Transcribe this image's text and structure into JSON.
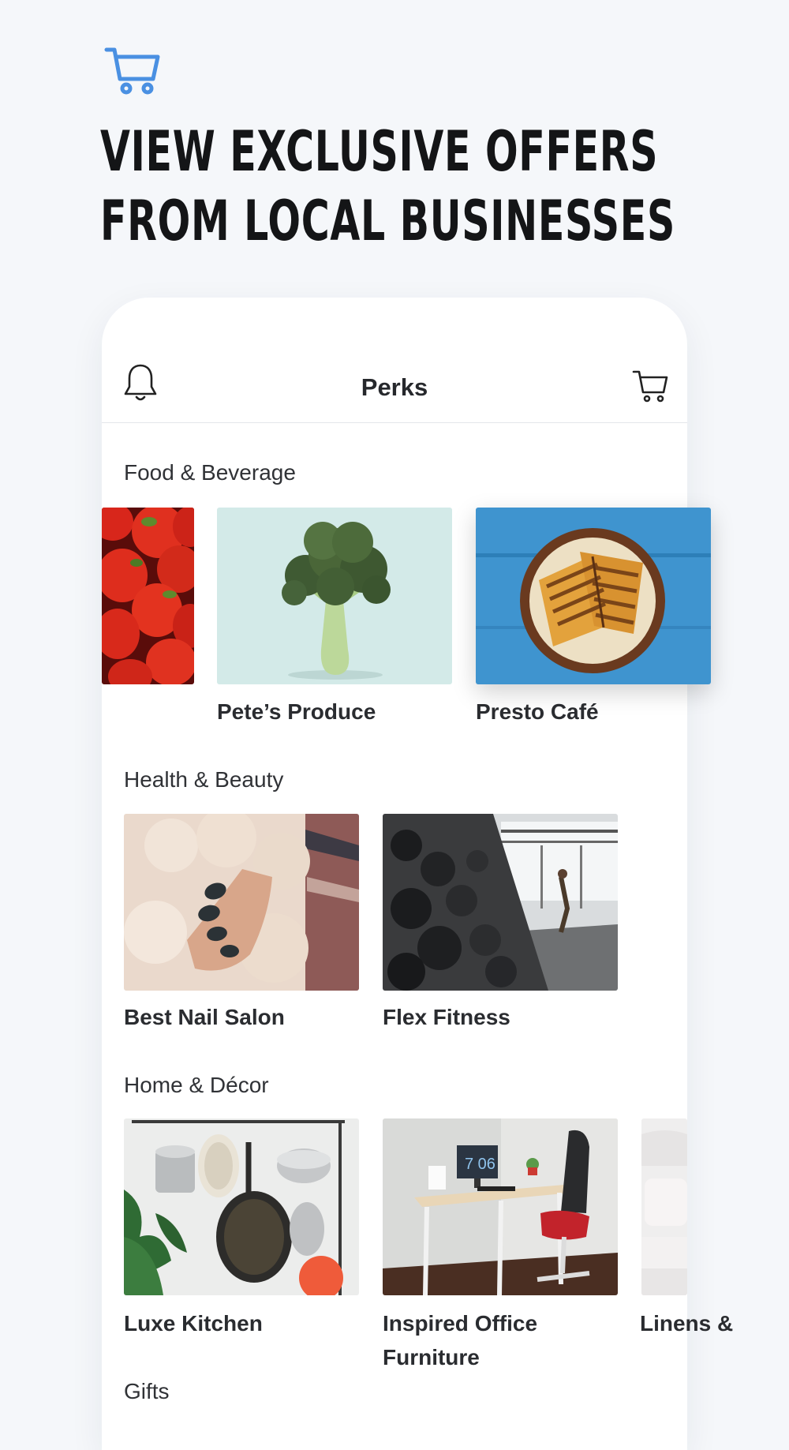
{
  "headline": {
    "line1": "VIEW EXCLUSIVE OFFERS",
    "line2": "FROM LOCAL BUSINESSES"
  },
  "header": {
    "title": "Perks"
  },
  "sections": [
    {
      "title": "Food & Beverage",
      "items": [
        {
          "label": "",
          "image": "strawberries"
        },
        {
          "label": "Pete’s Produce",
          "image": "broccoli"
        },
        {
          "label": "Presto Café",
          "image": "grilled-sandwich"
        }
      ]
    },
    {
      "title": "Health & Beauty",
      "items": [
        {
          "label": "Best Nail Salon",
          "image": "manicure"
        },
        {
          "label": "Flex Fitness",
          "image": "gym-dumbbells"
        }
      ]
    },
    {
      "title": "Home & Décor",
      "items": [
        {
          "label": "Luxe Kitchen",
          "image": "hanging-pans"
        },
        {
          "label_line1": "Inspired Office",
          "label_line2": "Furniture",
          "image": "office-desk"
        },
        {
          "label": "Linens &",
          "image": "white-bed"
        }
      ]
    },
    {
      "title": "Gifts"
    }
  ],
  "colors": {
    "accent": "#4a90e2",
    "background": "#f5f7fa",
    "card": "#ffffff",
    "text": "#1f2125"
  },
  "icons": {
    "hero": "cart-icon",
    "header_left": "bell-icon",
    "header_right": "cart-icon"
  }
}
